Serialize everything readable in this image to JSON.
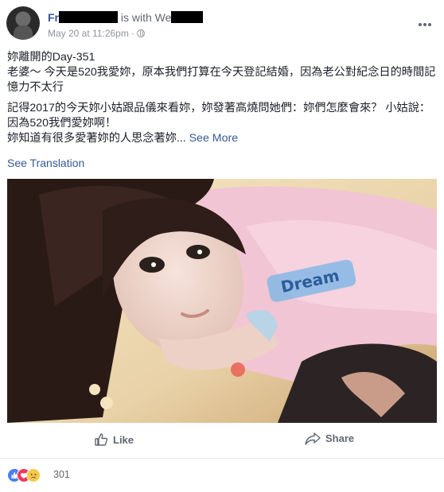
{
  "post": {
    "author_visible": "Fr",
    "with_text": "is with We",
    "timestamp": "May 20 at 11:26pm",
    "separator": "·",
    "paragraphs": [
      "妳離開的Day-351",
      "老婆～ 今天是520我愛妳，原本我們打算在今天登記結婚，因為老公對紀念日的時間記憶力不太行",
      "記得2017的今天妳小姑跟品儀來看妳，妳發著高燒問她們：妳們怎麼會來？ 小姑說：因為520我們愛妳啊！",
      "妳知道有很多愛著妳的人思念著妳..."
    ],
    "see_more": "See More",
    "see_translation": "See Translation"
  },
  "actions": {
    "like_label": "Like",
    "share_label": "Share"
  },
  "reactions": {
    "count": "301",
    "types": [
      "like",
      "love",
      "sad"
    ]
  },
  "photo_embedded_text": "Dream"
}
